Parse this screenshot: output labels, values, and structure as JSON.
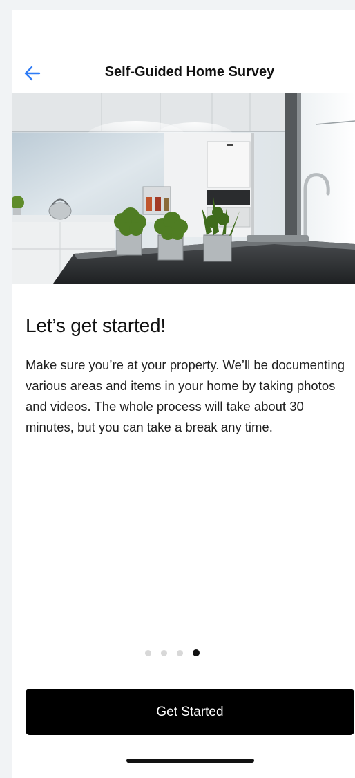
{
  "nav": {
    "title": "Self-Guided Home Survey",
    "back_icon": "arrow-left-icon",
    "accent_color": "#2f7cf6"
  },
  "hero": {
    "icon": "kitchen-photo"
  },
  "content": {
    "heading": "Let’s get started!",
    "body": "Make sure you’re at your property. We’ll be documenting various areas and items in your home by taking photos and videos. The whole process will take about 30 minutes, but you can take a break any time."
  },
  "pagination": {
    "total": 4,
    "current": 4
  },
  "cta": {
    "label": "Get Started",
    "background": "#000000",
    "text_color": "#ffffff"
  }
}
